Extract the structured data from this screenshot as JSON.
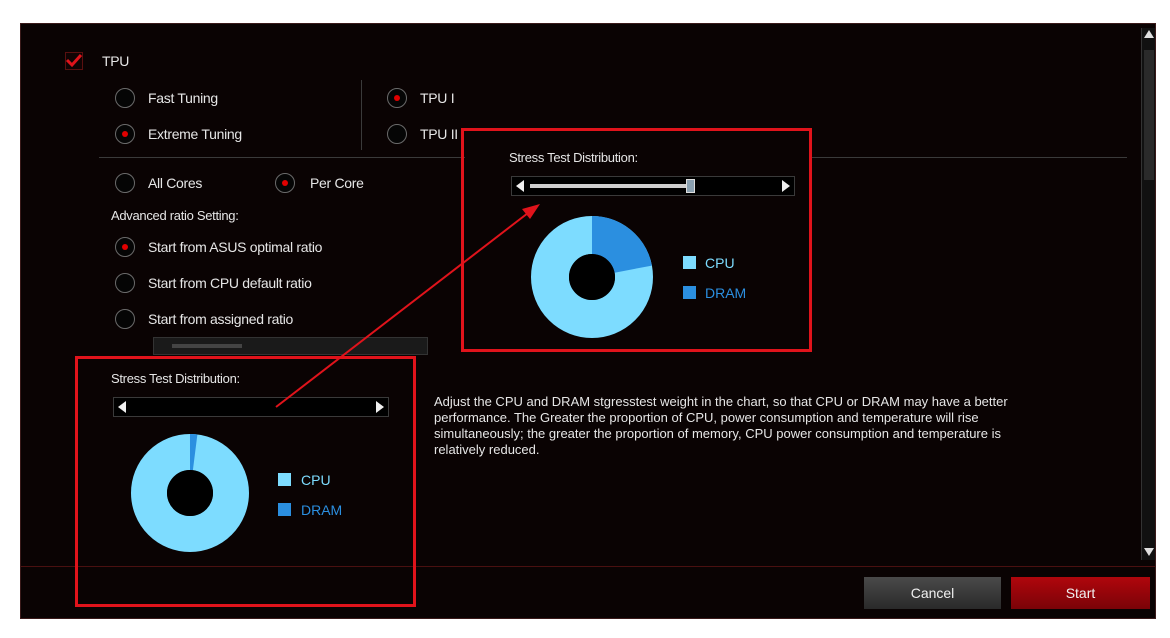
{
  "tpu": {
    "label": "TPU",
    "checked": true,
    "tuning_options": [
      {
        "label": "Fast Tuning",
        "selected": false
      },
      {
        "label": "Extreme Tuning",
        "selected": true
      }
    ],
    "tpu_modes": [
      {
        "label": "TPU I",
        "selected": true
      },
      {
        "label": "TPU II",
        "selected": false
      }
    ]
  },
  "cores": [
    {
      "label": "All Cores",
      "selected": false
    },
    {
      "label": "Per Core",
      "selected": true
    }
  ],
  "advanced": {
    "heading": "Advanced ratio Setting:",
    "options": [
      {
        "label": "Start from ASUS optimal ratio",
        "selected": true
      },
      {
        "label": "Start from CPU default ratio",
        "selected": false
      },
      {
        "label": "Start from assigned ratio",
        "selected": false
      }
    ]
  },
  "stress_main": {
    "title": "Stress Test Distribution:",
    "cpu_fraction": 0.98,
    "legend": [
      {
        "label": "CPU",
        "color": "#7ddcff"
      },
      {
        "label": "DRAM",
        "color": "#2b8fe0"
      }
    ]
  },
  "stress_zoom": {
    "title": "Stress Test Distribution:",
    "cpu_fraction": 0.78,
    "legend": [
      {
        "label": "CPU",
        "color": "#7ddcff"
      },
      {
        "label": "DRAM",
        "color": "#2b8fe0"
      }
    ]
  },
  "description": "Adjust the CPU and DRAM stgresstest weight in the chart, so that CPU or DRAM may have a better performance. The Greater the proportion of CPU, power consumption and temperature will rise simultaneously; the greater the proportion of memory, CPU power consumption and temperature is relatively reduced.",
  "buttons": {
    "cancel": "Cancel",
    "start": "Start"
  },
  "colors": {
    "accent": "#e0131b",
    "cpu": "#7ddcff",
    "dram": "#2b8fe0"
  }
}
